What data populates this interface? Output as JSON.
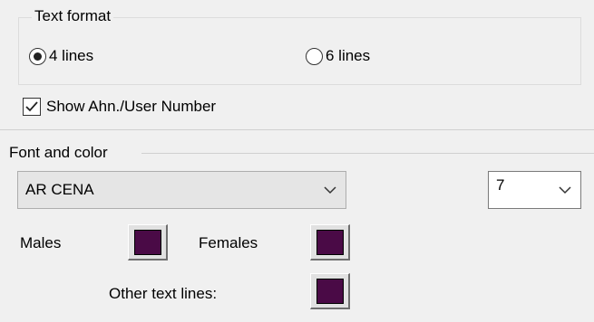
{
  "text_format": {
    "legend": "Text format",
    "options": [
      {
        "label": "4 lines",
        "selected": true
      },
      {
        "label": "6 lines",
        "selected": false
      }
    ]
  },
  "show_number": {
    "label": "Show Ahn./User Number",
    "checked": true
  },
  "font_color": {
    "legend": "Font and color",
    "font_value": "AR CENA",
    "size_value": "7",
    "males_label": "Males",
    "females_label": "Females",
    "other_label": "Other text lines:",
    "swatch_color": "#4a0a46"
  }
}
